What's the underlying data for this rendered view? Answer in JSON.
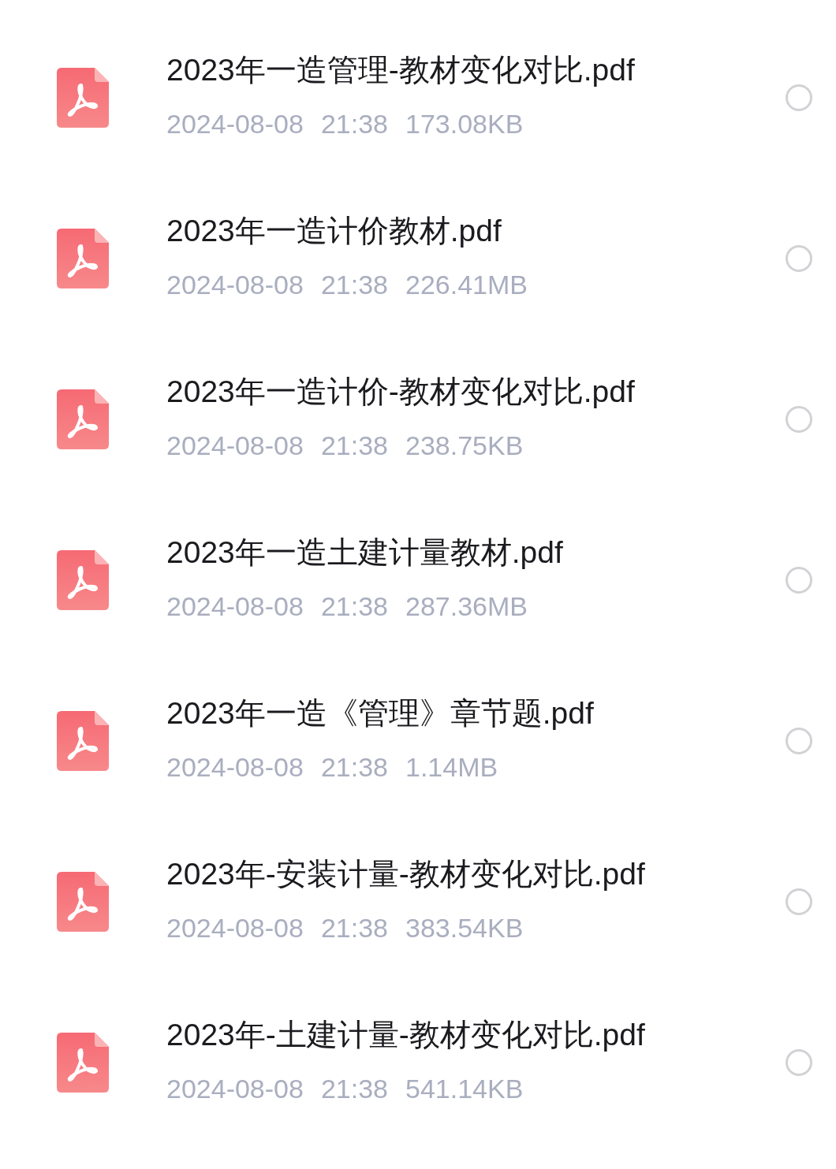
{
  "files": [
    {
      "name": "2023年一造管理-教材变化对比.pdf",
      "date": "2024-08-08",
      "time": "21:38",
      "size": "173.08KB",
      "selected": false
    },
    {
      "name": "2023年一造计价教材.pdf",
      "date": "2024-08-08",
      "time": "21:38",
      "size": "226.41MB",
      "selected": false
    },
    {
      "name": "2023年一造计价-教材变化对比.pdf",
      "date": "2024-08-08",
      "time": "21:38",
      "size": "238.75KB",
      "selected": false
    },
    {
      "name": "2023年一造土建计量教材.pdf",
      "date": "2024-08-08",
      "time": "21:38",
      "size": "287.36MB",
      "selected": false
    },
    {
      "name": "2023年一造《管理》章节题.pdf",
      "date": "2024-08-08",
      "time": "21:38",
      "size": "1.14MB",
      "selected": false
    },
    {
      "name": "2023年-安装计量-教材变化对比.pdf",
      "date": "2024-08-08",
      "time": "21:38",
      "size": "383.54KB",
      "selected": false
    },
    {
      "name": "2023年-土建计量-教材变化对比.pdf",
      "date": "2024-08-08",
      "time": "21:38",
      "size": "541.14KB",
      "selected": false
    }
  ]
}
